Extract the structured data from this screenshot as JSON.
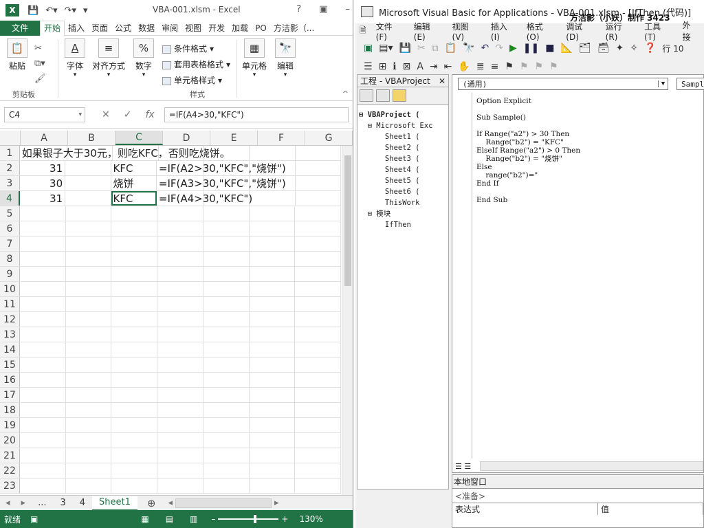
{
  "excel": {
    "title": "VBA-001.xlsm - Excel",
    "file_tab": "文件",
    "tabs": [
      "开始",
      "插入",
      "页面",
      "公式",
      "数据",
      "审阅",
      "视图",
      "开发",
      "加载",
      "PO",
      "方洁影（..."
    ],
    "clipboard": {
      "paste": "粘贴",
      "group": "剪贴板"
    },
    "font_label": "字体",
    "align_label": "对齐方式",
    "number_label": "数字",
    "styles": {
      "cond": "条件格式",
      "table": "套用表格格式",
      "cell": "单元格样式",
      "group": "样式"
    },
    "cells_label": "单元格",
    "edit_label": "编辑",
    "name_box": "C4",
    "formula": "=IF(A4>30,\"KFC\")",
    "fx": "fx",
    "columns": [
      "A",
      "B",
      "C",
      "D",
      "E",
      "F",
      "G"
    ],
    "rows": [
      {
        "n": "1",
        "a": "",
        "b": "",
        "c": "",
        "d": "",
        "e": "",
        "span": "如果银子大于30元，则吃KFC，否则吃烧饼。"
      },
      {
        "n": "2",
        "a": "31",
        "b": "",
        "c": "KFC",
        "d": "=IF(A2>30,\"KFC\",\"烧饼\")",
        "span": ""
      },
      {
        "n": "3",
        "a": "30",
        "b": "",
        "c": "烧饼",
        "d": "=IF(A3>30,\"KFC\",\"烧饼\")",
        "span": ""
      },
      {
        "n": "4",
        "a": "31",
        "b": "",
        "c": "KFC",
        "d": "=IF(A4>30,\"KFC\")",
        "span": ""
      },
      {
        "n": "5"
      },
      {
        "n": "6"
      },
      {
        "n": "7"
      },
      {
        "n": "8"
      },
      {
        "n": "9"
      },
      {
        "n": "10"
      },
      {
        "n": "11"
      },
      {
        "n": "12"
      },
      {
        "n": "13"
      },
      {
        "n": "14"
      },
      {
        "n": "15"
      },
      {
        "n": "16"
      },
      {
        "n": "17"
      },
      {
        "n": "18"
      },
      {
        "n": "19"
      },
      {
        "n": "20"
      },
      {
        "n": "21"
      },
      {
        "n": "22"
      },
      {
        "n": "23"
      }
    ],
    "sheet_tabs": [
      "...",
      "3",
      "4",
      "Sheet1"
    ],
    "status": "就绪",
    "zoom": "130%"
  },
  "vba": {
    "title": "Microsoft Visual Basic for Applications - VBA-001.xlsm - [IfThen (代码)]",
    "watermark": "方洁影（小妖）制作 3423",
    "menu": [
      "文件(F)",
      "编辑(E)",
      "视图(V)",
      "插入(I)",
      "格式(O)",
      "调试(D)",
      "运行(R)",
      "工具(T)",
      "外接"
    ],
    "row_label": "行 10",
    "project_title": "工程 - VBAProject",
    "tree": [
      "⊟ VBAProject (",
      "  ⊟ Microsoft Exc",
      "      Sheet1 (",
      "      Sheet2 (",
      "      Sheet3 (",
      "      Sheet4 (",
      "      Sheet5 (",
      "      Sheet6 (",
      "      ThisWork",
      "  ⊟ 模块",
      "      IfThen"
    ],
    "combo_left": "(通用)",
    "combo_right": "Sampl",
    "code": "Option Explicit\n\nSub Sample()\n\nIf Range(\"a2\") > 30 Then\n    Range(\"b2\") = \"KFC\"\nElseIf Range(\"a2\") > 0 Then\n    Range(\"b2\") = \"烧饼\"\nElse\n    range(\"b2\")=\"\nEnd If\n\nEnd Sub",
    "immediate_title": "本地窗口",
    "immediate_msg": "<准备>",
    "col_expr": "表达式",
    "col_val": "值"
  }
}
